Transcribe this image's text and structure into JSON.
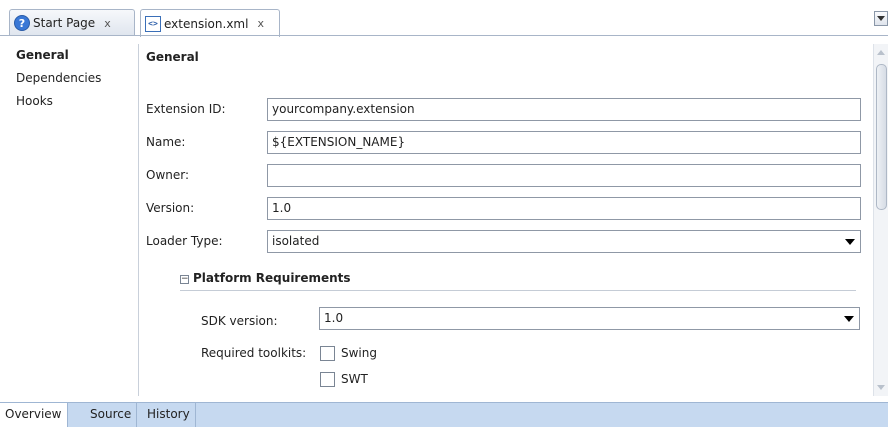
{
  "tabs": [
    {
      "label": "Start Page",
      "close": "x",
      "icon": "help-icon",
      "active": false
    },
    {
      "label": "extension.xml",
      "close": "x",
      "icon": "xml-file-icon",
      "active": true
    }
  ],
  "icons": {
    "help_glyph": "?",
    "xml_glyph": "<>"
  },
  "nav": {
    "items": [
      {
        "label": "General",
        "selected": true
      },
      {
        "label": "Dependencies",
        "selected": false
      },
      {
        "label": "Hooks",
        "selected": false
      }
    ]
  },
  "general": {
    "title": "General",
    "extension_id": {
      "label": "Extension ID:",
      "value": "yourcompany.extension"
    },
    "name": {
      "label": "Name:",
      "value": "${EXTENSION_NAME}"
    },
    "owner": {
      "label": "Owner:",
      "value": ""
    },
    "version": {
      "label": "Version:",
      "value": "1.0"
    },
    "loader_type": {
      "label": "Loader Type:",
      "value": "isolated"
    }
  },
  "platform": {
    "title": "Platform Requirements",
    "collapse_glyph": "−",
    "sdk_version": {
      "label": "SDK version:",
      "value": "1.0"
    },
    "required_toolkits": {
      "label": "Required toolkits:",
      "options": [
        {
          "label": "Swing",
          "checked": false
        },
        {
          "label": "SWT",
          "checked": false
        }
      ]
    }
  },
  "bottom_tabs": [
    {
      "label": "Overview",
      "active": true
    },
    {
      "label": "Source",
      "active": false
    },
    {
      "label": "History",
      "active": false
    }
  ],
  "colors": {
    "accent_blue": "#3a78d6",
    "bottom_bar": "#c6d9f0",
    "border": "#8f98a6"
  }
}
